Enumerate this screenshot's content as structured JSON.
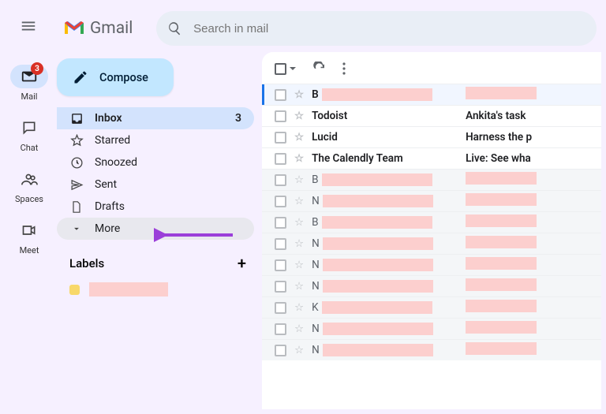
{
  "app": {
    "name": "Gmail"
  },
  "search": {
    "placeholder": "Search in mail"
  },
  "rail": {
    "mail": {
      "label": "Mail",
      "badge": "3"
    },
    "chat": {
      "label": "Chat"
    },
    "spaces": {
      "label": "Spaces"
    },
    "meet": {
      "label": "Meet"
    }
  },
  "sidebar": {
    "compose": "Compose",
    "items": [
      {
        "icon": "inbox",
        "label": "Inbox",
        "count": "3",
        "selected": true
      },
      {
        "icon": "star",
        "label": "Starred"
      },
      {
        "icon": "clock",
        "label": "Snoozed"
      },
      {
        "icon": "send",
        "label": "Sent"
      },
      {
        "icon": "file",
        "label": "Drafts"
      },
      {
        "icon": "chevron",
        "label": "More",
        "hover": true
      }
    ],
    "labels_header": "Labels"
  },
  "list": {
    "rows": [
      {
        "sender": "B",
        "subject": "",
        "unread": true,
        "selected": true,
        "redact_sender": true,
        "redact_subj": true
      },
      {
        "sender": "Todoist",
        "subject": "Ankita's task",
        "unread": true
      },
      {
        "sender": "Lucid",
        "subject": "Harness the p",
        "unread": true
      },
      {
        "sender": "The Calendly Team",
        "subject": "Live: See wha",
        "unread": true
      },
      {
        "sender": "B",
        "subject": "",
        "unread": false,
        "redact_sender": true,
        "redact_subj": true
      },
      {
        "sender": "N",
        "subject": "",
        "unread": false,
        "redact_sender": true,
        "redact_subj": true
      },
      {
        "sender": "B",
        "subject": "",
        "unread": false,
        "redact_sender": true,
        "redact_subj": true
      },
      {
        "sender": "N",
        "subject": "",
        "unread": false,
        "redact_sender": true,
        "redact_subj": true
      },
      {
        "sender": "N",
        "subject": "",
        "unread": false,
        "redact_sender": true,
        "redact_subj": true
      },
      {
        "sender": "N",
        "subject": "",
        "unread": false,
        "redact_sender": true,
        "redact_subj": true
      },
      {
        "sender": "K",
        "subject": "",
        "unread": false,
        "redact_sender": true,
        "redact_subj": true
      },
      {
        "sender": "N",
        "subject": "",
        "unread": false,
        "redact_sender": true,
        "redact_subj": true
      },
      {
        "sender": "N",
        "subject": "",
        "unread": false,
        "redact_sender": true,
        "redact_subj": true
      }
    ]
  }
}
